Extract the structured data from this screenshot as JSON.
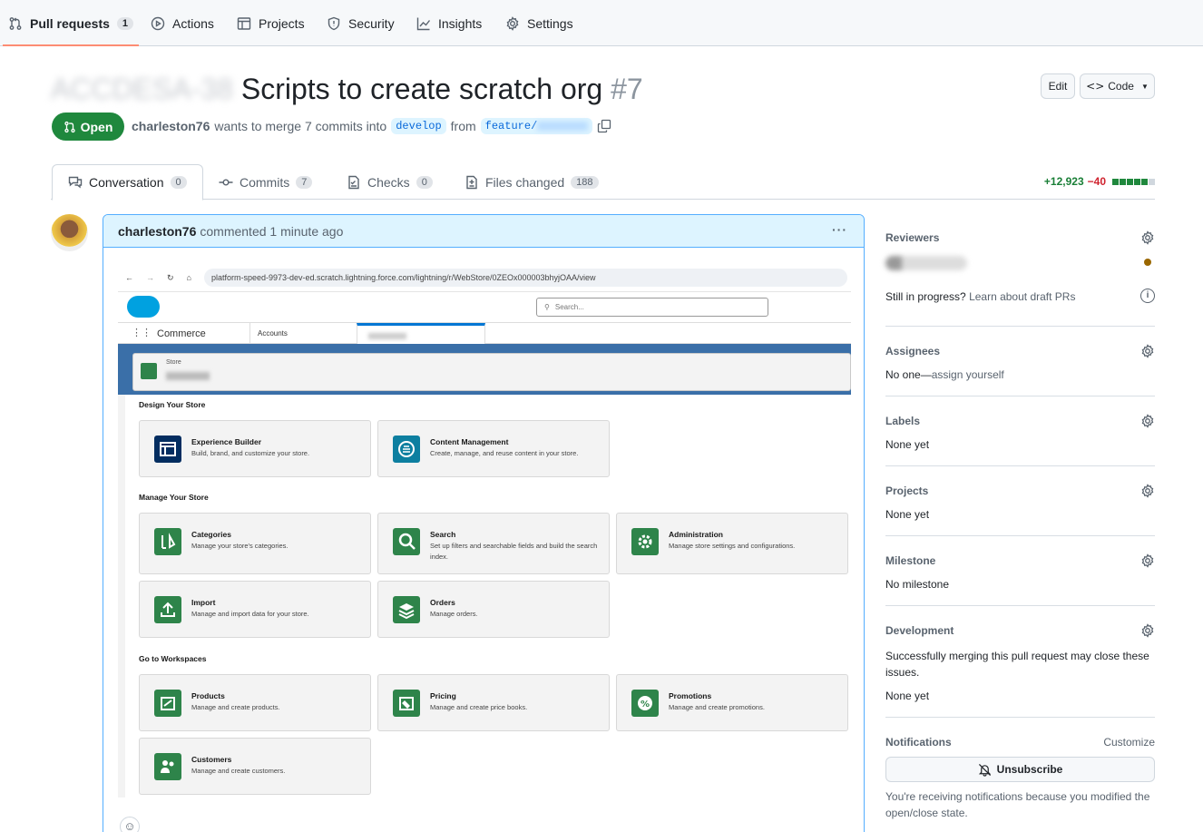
{
  "topnav": [
    {
      "label": "Pull requests",
      "count": "1",
      "icon": "pull-request-icon",
      "active": true
    },
    {
      "label": "Actions",
      "icon": "play-icon"
    },
    {
      "label": "Projects",
      "icon": "table-icon"
    },
    {
      "label": "Security",
      "icon": "shield-icon"
    },
    {
      "label": "Insights",
      "icon": "graph-icon"
    },
    {
      "label": "Settings",
      "icon": "gear-icon"
    }
  ],
  "pr": {
    "title_prefix": "ACCDESA-38",
    "title": "Scripts to create scratch org",
    "number": "#7",
    "state": "Open",
    "author": "charleston76",
    "merge_text": "wants to merge 7 commits into",
    "base_branch": "develop",
    "from_text": "from",
    "head_branch": "feature/"
  },
  "buttons": {
    "edit": "Edit",
    "code": "Code",
    "unsubscribe": "Unsubscribe"
  },
  "tabs": [
    {
      "label": "Conversation",
      "count": "0",
      "icon": "comment-icon"
    },
    {
      "label": "Commits",
      "count": "7",
      "icon": "commit-icon"
    },
    {
      "label": "Checks",
      "count": "0",
      "icon": "checklist-icon"
    },
    {
      "label": "Files changed",
      "count": "188",
      "icon": "file-diff-icon"
    }
  ],
  "diffstat": {
    "additions": "+12,923",
    "deletions": "−40"
  },
  "comment": {
    "author": "charleston76",
    "meta": "commented 1 minute ago"
  },
  "screenshot": {
    "url": "platform-speed-9973-dev-ed.scratch.lightning.force.com/lightning/r/WebStore/0ZEOx000003bhyjOAA/view",
    "search_placeholder": "Search...",
    "app_name": "Commerce",
    "nav_tab_accounts": "Accounts",
    "store_label": "Store",
    "sections": {
      "design": "Design Your Store",
      "manage": "Manage Your Store",
      "workspaces": "Go to Workspaces"
    },
    "tiles": [
      {
        "title": "Experience Builder",
        "desc": "Build, brand, and customize your store."
      },
      {
        "title": "Content Management",
        "desc": "Create, manage, and reuse content in your store."
      },
      {
        "title": "Categories",
        "desc": "Manage your store's categories."
      },
      {
        "title": "Search",
        "desc": "Set up filters and searchable fields and build the search index."
      },
      {
        "title": "Administration",
        "desc": "Manage store settings and configurations."
      },
      {
        "title": "Import",
        "desc": "Manage and import data for your store."
      },
      {
        "title": "Orders",
        "desc": "Manage orders."
      },
      {
        "title": "Products",
        "desc": "Manage and create products."
      },
      {
        "title": "Pricing",
        "desc": "Manage and create price books."
      },
      {
        "title": "Promotions",
        "desc": "Manage and create promotions."
      },
      {
        "title": "Customers",
        "desc": "Manage and create customers."
      }
    ]
  },
  "sidebar": {
    "reviewers": "Reviewers",
    "draft_text": "Still in progress?",
    "draft_link": "Learn about draft PRs",
    "assignees": "Assignees",
    "assignees_value": "No one—",
    "assign_link": "assign yourself",
    "labels": "Labels",
    "labels_value": "None yet",
    "projects": "Projects",
    "projects_value": "None yet",
    "milestone": "Milestone",
    "milestone_value": "No milestone",
    "development": "Development",
    "development_text": "Successfully merging this pull request may close these issues.",
    "development_value": "None yet",
    "notifications": "Notifications",
    "customize": "Customize",
    "notif_text": "You're receiving notifications because you modified the open/close state."
  },
  "colors": {
    "open_green": "#1f883d",
    "accent_blue": "#0969da",
    "sf_green": "#2e844a"
  }
}
